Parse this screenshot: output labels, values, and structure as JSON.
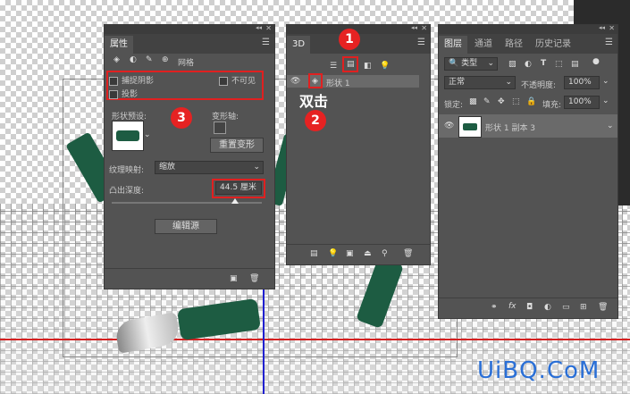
{
  "properties_panel": {
    "tab_label": "属性",
    "mesh_label": "网格",
    "capture_shadow": "捕捉阴影",
    "invisible": "不可见",
    "cast_shadow": "投影",
    "shape_preset": "形状预设:",
    "deform_axis": "变形轴:",
    "reset_deform": "重置变形",
    "texture_map": "纹理映射:",
    "texture_value": "缩放",
    "extrusion_depth": "凸出深度:",
    "extrusion_value": "44.5 厘米",
    "slider_value": 0.82,
    "edit_source": "编辑源"
  },
  "panel_3d": {
    "tab_label": "3D",
    "layer_name": "形状 1",
    "double_click": "双击"
  },
  "layers_panel": {
    "tabs": [
      "图层",
      "通道",
      "路径",
      "历史记录"
    ],
    "filter_kind": "类型",
    "blend_mode": "正常",
    "opacity_label": "不透明度:",
    "opacity_value": "100%",
    "lock_label": "锁定:",
    "fill_label": "填充:",
    "fill_value": "100%",
    "layer_name": "形状 1 副本 3"
  },
  "badges": [
    "1",
    "2",
    "3"
  ],
  "watermark": "UiBQ.CoM",
  "colors": {
    "accent_red": "#e02020",
    "panel_bg": "#535353",
    "watermark": "#2a6fd6"
  }
}
